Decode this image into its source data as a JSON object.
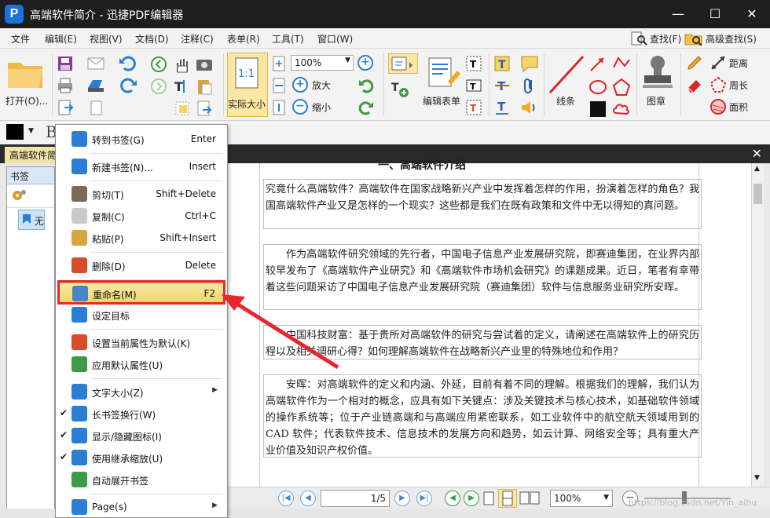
{
  "window": {
    "title": "高端软件简介 - 迅捷PDF编辑器",
    "logo_letter": "P",
    "controls": {
      "minimize": "—",
      "maximize": "☐",
      "close": "✕"
    }
  },
  "menubar": {
    "items": [
      "文件",
      "编辑(E)",
      "视图(V)",
      "文档(D)",
      "注释(C)",
      "表单(R)",
      "工具(T)",
      "窗口(W)"
    ],
    "find_label": "查找(F)",
    "advanced_find_label": "高级查找(S)"
  },
  "toolbar": {
    "open_label": "打开(O)...",
    "actual_size_label": "实际大小",
    "zoom_value": "100%",
    "zoom_in_label": "放大",
    "zoom_out_label": "缩小",
    "edit_form_label": "编辑表单",
    "line_label": "线条",
    "stamp_label": "图章",
    "distance_label": "距离",
    "perimeter_label": "周长",
    "area_label": "面积",
    "one_to_one": "1:1"
  },
  "tabs": {
    "doc_tab": "高端软件简",
    "close": "✕"
  },
  "bookmark_panel": {
    "title": "书签",
    "item": "无标"
  },
  "document": {
    "heading_partial": "一、高端软件介绍",
    "paragraphs": [
      "究竟什么高端软件？高端软件在国家战略新兴产业中发挥着怎样的作用，扮演着怎样的角色？我国高端软件产业又是怎样的一个现实？这些都是我们在既有政策和文件中无以得知的真问题。",
      "作为高端软件研究领域的先行者，中国电子信息产业发展研究院，即赛迪集团，在业界内部较早发布了《高端软件产业研究》和《高端软件市场机会研究》的课题成果。近日，笔者有幸带着这些问题采访了中国电子信息产业发展研究院（赛迪集团）软件与信息服务业研究所安晖。",
      "中国科技财富：基于贵所对高端软件的研究与尝试着的定义，请阐述在高端软件上的研究历程以及相关调研心得？如何理解高端软件在战略新兴产业里的特殊地位和作用？",
      "安晖：对高端软件的定义和内涵、外延，目前有着不同的理解。根据我们的理解，我们认为高端软件作为一个相对的概念，应具有如下关键点：涉及关键技术与核心技术，如基础软件领域的操作系统等；位于产业链高端和与高端应用紧密联系，如工业软件中的航空航天领域用到的 CAD 软件；代表软件技术、信息技术的发展方向和趋势，如云计算、网络安全等；具有重大产业价值及知识产权价值。"
    ]
  },
  "statusbar": {
    "page_value": "1/5",
    "zoom_value": "100%"
  },
  "context_menu": {
    "items": [
      {
        "label": "转到书签(G)",
        "shortcut": "Enter",
        "icon": "goto-bookmark-icon",
        "color": "#2a7fd4"
      },
      {
        "label": "新建书签(N)...",
        "shortcut": "Insert",
        "icon": "new-bookmark-icon",
        "color": "#2a7fd4"
      },
      {
        "label": "剪切(T)",
        "shortcut": "Shift+Delete",
        "icon": "scissors-icon",
        "color": "#7a6a5a"
      },
      {
        "label": "复制(C)",
        "shortcut": "Ctrl+C",
        "icon": "copy-icon",
        "color": "#c9c9c9"
      },
      {
        "label": "粘贴(P)",
        "shortcut": "Shift+Insert",
        "icon": "paste-icon",
        "color": "#d8a640"
      },
      {
        "label": "删除(D)",
        "shortcut": "Delete",
        "icon": "trash-icon",
        "color": "#d84a2a"
      },
      {
        "label": "重命名(M)",
        "shortcut": "F2",
        "icon": "rename-icon",
        "color": "#4a87c8"
      },
      {
        "label": "设定目标",
        "shortcut": "",
        "icon": "set-target-icon",
        "color": "#2a7fd4"
      },
      {
        "label": "设置当前属性为默认(K)",
        "shortcut": "",
        "icon": "set-default-props-icon",
        "color": "#d84a2a"
      },
      {
        "label": "应用默认属性(U)",
        "shortcut": "",
        "icon": "apply-default-props-icon",
        "color": "#3c9b44"
      },
      {
        "label": "文字大小(Z)",
        "shortcut": "",
        "icon": "text-size-icon",
        "color": "#2a7fd4"
      },
      {
        "label": "长书签换行(W)",
        "shortcut": "",
        "icon": "wrap-bookmark-icon",
        "color": "#2a7fd4"
      },
      {
        "label": "显示/隐藏图标(I)",
        "shortcut": "",
        "icon": "show-hide-icon",
        "color": "#2a7fd4"
      },
      {
        "label": "使用继承缩放(U)",
        "shortcut": "",
        "icon": "inherit-zoom-icon",
        "color": "#2a7fd4"
      },
      {
        "label": "自动展开书签",
        "shortcut": "",
        "icon": "auto-expand-icon",
        "color": "#3c9b44"
      },
      {
        "label": "Page(s)",
        "shortcut": "",
        "icon": "pages-icon",
        "color": "#2a7fd4"
      }
    ],
    "checked": [
      "长书签换行(W)",
      "显示/隐藏图标(I)",
      "使用继承缩放(U)"
    ],
    "submenu": [
      "文字大小(Z)",
      "Page(s)"
    ],
    "highlighted": "重命名(M)"
  },
  "colors": {
    "highlight_border": "#e8262c",
    "accent": "#2a7fd4"
  },
  "watermark": "https://blog.csdn.net/Yin_aihu"
}
